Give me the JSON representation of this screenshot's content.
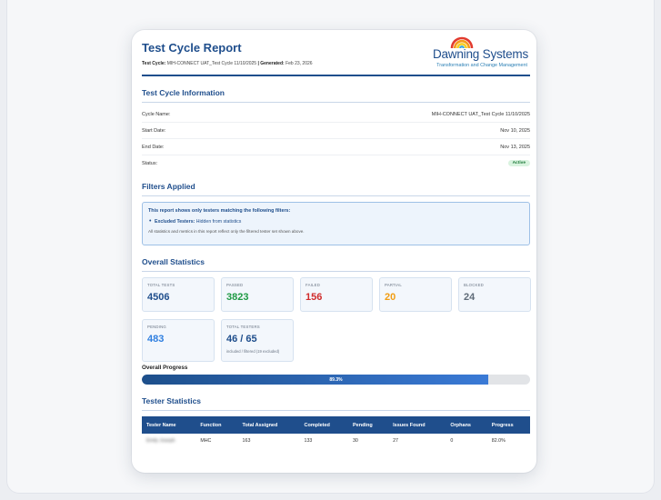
{
  "report": {
    "title": "Test Cycle Report",
    "cycle_label": "Test Cycle:",
    "cycle_value": "MIH-CONNECT UAT_Test Cycle 11/10/2025",
    "separator": " | ",
    "generated_label": "Generated:",
    "generated_value": "Feb 23, 2026"
  },
  "logo": {
    "name": "Dawning Systems",
    "tagline": "Transformation and Change Management",
    "colors": [
      "#e23b2e",
      "#f59a1c",
      "#f6cf25",
      "#3aa6dd"
    ]
  },
  "cycle_info": {
    "title": "Test Cycle Information",
    "rows": [
      {
        "label": "Cycle Name:",
        "value": "MIH-CONNECT UAT_Test Cycle 11/10/2025"
      },
      {
        "label": "Start Date:",
        "value": "Nov 10, 2025"
      },
      {
        "label": "End Date:",
        "value": "Nov 13, 2025"
      },
      {
        "label": "Status:",
        "value": "Active"
      }
    ]
  },
  "filters": {
    "title": "Filters Applied",
    "intro": "This report shows only testers matching the following filters:",
    "item_label": "Excluded Testers:",
    "item_value": "Hidden from statistics",
    "note": "All statistics and metrics in this report reflect only the filtered tester set shown above."
  },
  "overall": {
    "title": "Overall Statistics",
    "cards": [
      {
        "label": "Total Tests",
        "value": "4506",
        "color": "#1f4e8c"
      },
      {
        "label": "Passed",
        "value": "3823",
        "color": "#1f9a44"
      },
      {
        "label": "Failed",
        "value": "156",
        "color": "#d02b2b"
      },
      {
        "label": "Partial",
        "value": "20",
        "color": "#f29d12"
      },
      {
        "label": "Blocked",
        "value": "24",
        "color": "#5f6b78"
      },
      {
        "label": "Pending",
        "value": "483",
        "color": "#2f7fe0"
      },
      {
        "label": "Total Testers",
        "value": "46 / 65",
        "color": "#1f4e8c",
        "sub": "included / filtered (19 excluded)"
      }
    ],
    "progress_label": "Overall Progress",
    "progress_value": 89.3,
    "progress_text": "89.3%"
  },
  "tester_stats": {
    "title": "Tester Statistics",
    "headers": [
      "Tester Name",
      "Function",
      "Total Assigned",
      "Completed",
      "Pending",
      "Issues Found",
      "Orphans",
      "Progress"
    ],
    "rows": [
      [
        "Emily Joseph",
        "MHC",
        "163",
        "133",
        "30",
        "27",
        "0",
        "82.0%"
      ]
    ]
  }
}
